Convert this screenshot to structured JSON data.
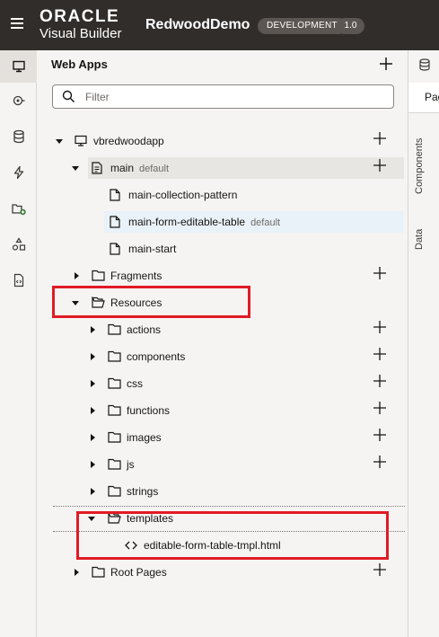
{
  "header": {
    "logo_line1": "ORACLE",
    "logo_line2": "Visual Builder",
    "app_name": "RedwoodDemo",
    "env_badge": "DEVELOPMENT",
    "version_badge": "1.0"
  },
  "rail": {
    "items": [
      "web-apps",
      "services",
      "business-objects",
      "processes",
      "components",
      "mobile",
      "source"
    ],
    "active": "web-apps"
  },
  "panel": {
    "title": "Web Apps",
    "filter_placeholder": "Filter",
    "tree": {
      "app": "vbredwoodapp",
      "main": "main",
      "main_tag": "default",
      "main_children": [
        "main-collection-pattern",
        "main-form-editable-table",
        "main-start"
      ],
      "default_page_tag": "default",
      "fragments": "Fragments",
      "resources": "Resources",
      "resource_folders": [
        "actions",
        "components",
        "css",
        "functions",
        "images",
        "js",
        "strings"
      ],
      "templates": "templates",
      "template_file": "editable-form-table-tmpl.html",
      "root_pages": "Root Pages"
    }
  },
  "right_panel": {
    "tab_head": "Pages",
    "tab_components": "Components",
    "tab_data": "Data"
  },
  "colors": {
    "header_bg": "#312d2a",
    "highlight_red": "#e01b24",
    "selected_bg": "#e9f2f8"
  }
}
